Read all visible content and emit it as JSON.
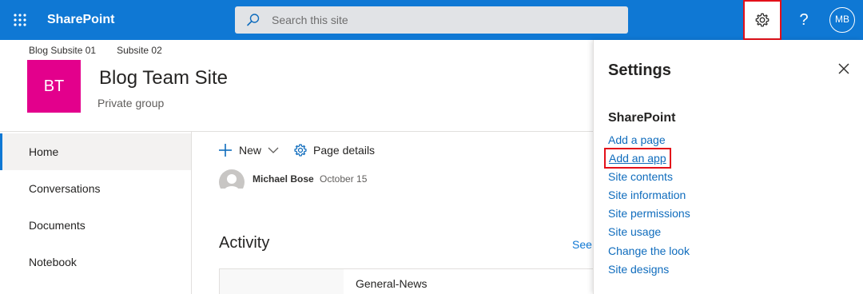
{
  "suitebar": {
    "brand": "SharePoint",
    "search_placeholder": "Search this site",
    "help_label": "?",
    "avatar_initials": "MB",
    "icons": {
      "waffle": "app-launcher-icon",
      "search": "search-icon",
      "settings": "gear-icon"
    }
  },
  "site": {
    "subsites": [
      "Blog Subsite 01",
      "Subsite 02"
    ],
    "logo_initials": "BT",
    "title": "Blog Team Site",
    "subtitle": "Private group"
  },
  "nav": {
    "items": [
      {
        "label": "Home",
        "active": true
      },
      {
        "label": "Conversations",
        "active": false
      },
      {
        "label": "Documents",
        "active": false
      },
      {
        "label": "Notebook",
        "active": false
      }
    ]
  },
  "commands": {
    "new_label": "New",
    "page_details_label": "Page details"
  },
  "content": {
    "author": "Michael Bose",
    "date": "October 15",
    "activity_heading": "Activity",
    "see_all": "See",
    "card_title": "General-News"
  },
  "settings_panel": {
    "title": "Settings",
    "section": "SharePoint",
    "links": [
      "Add a page",
      "Add an app",
      "Site contents",
      "Site information",
      "Site permissions",
      "Site usage",
      "Change the look",
      "Site designs"
    ],
    "highlighted_link": "Add an app"
  },
  "colors": {
    "suitebar": "#0f78d4",
    "site_logo": "#e3008c",
    "highlight_border": "#e3101a",
    "link": "#0f6cbd"
  }
}
